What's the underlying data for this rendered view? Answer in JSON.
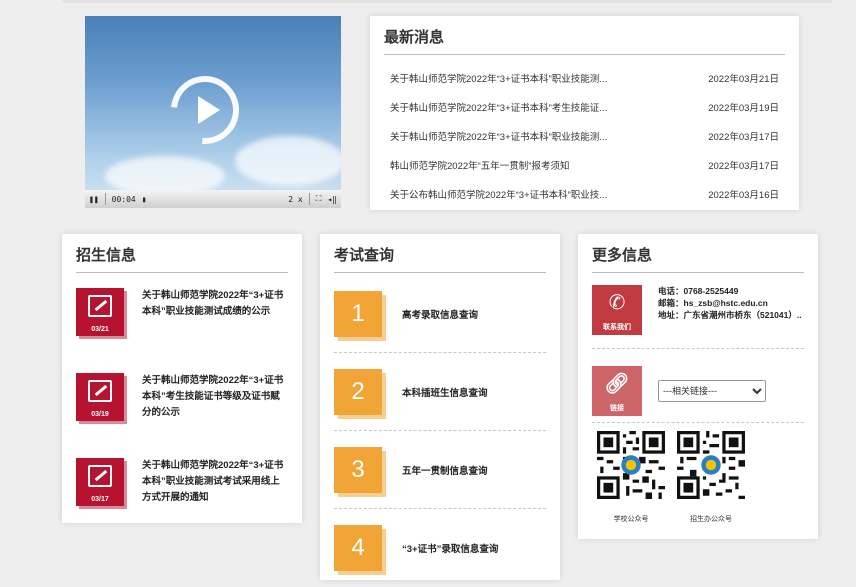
{
  "video": {
    "time": "00:04",
    "speed": "2 x"
  },
  "news": {
    "title": "最新消息",
    "items": [
      {
        "title": "关于韩山师范学院2022年“3+证书本科”职业技能测...",
        "date": "2022年03月21日"
      },
      {
        "title": "关于韩山师范学院2022年“3+证书本科”考生技能证...",
        "date": "2022年03月19日"
      },
      {
        "title": "关于韩山师范学院2022年“3+证书本科”职业技能测...",
        "date": "2022年03月17日"
      },
      {
        "title": "韩山师范学院2022年“五年一贯制”报考须知",
        "date": "2022年03月17日"
      },
      {
        "title": "关于公布韩山师范学院2022年“3+证书本科”职业技...",
        "date": "2022年03月16日"
      }
    ]
  },
  "admission": {
    "title": "招生信息",
    "items": [
      {
        "date": "03/21",
        "text": "关于韩山师范学院2022年“3+证书本科”职业技能测试成绩的公示"
      },
      {
        "date": "03/19",
        "text": "关于韩山师范学院2022年“3+证书本科”考生技能证书等级及证书赋分的公示"
      },
      {
        "date": "03/17",
        "text": "关于韩山师范学院2022年“3+证书本科”职业技能测试考试采用线上方式开展的通知"
      }
    ]
  },
  "exam": {
    "title": "考试查询",
    "items": [
      {
        "num": "1",
        "label": "高考录取信息查询"
      },
      {
        "num": "2",
        "label": "本科插班生信息查询"
      },
      {
        "num": "3",
        "label": "五年一贯制信息查询"
      },
      {
        "num": "4",
        "label": "“3+证书”录取信息查询"
      }
    ]
  },
  "more": {
    "title": "更多信息",
    "contact_label": "联系我们",
    "phone": "电话：0768-2525449",
    "email": "邮箱：hs_zsb@hstc.edu.cn",
    "address": "地址：广东省潮州市桥东（521041）..",
    "links_label": "链接",
    "links_select": "---相关链接---",
    "qr_school": "学校公众号",
    "qr_office": "招生办公众号"
  },
  "colors": {
    "admission_red": "#b5132f",
    "exam_orange": "#f0a536",
    "contact_red": "#c13a3f"
  }
}
